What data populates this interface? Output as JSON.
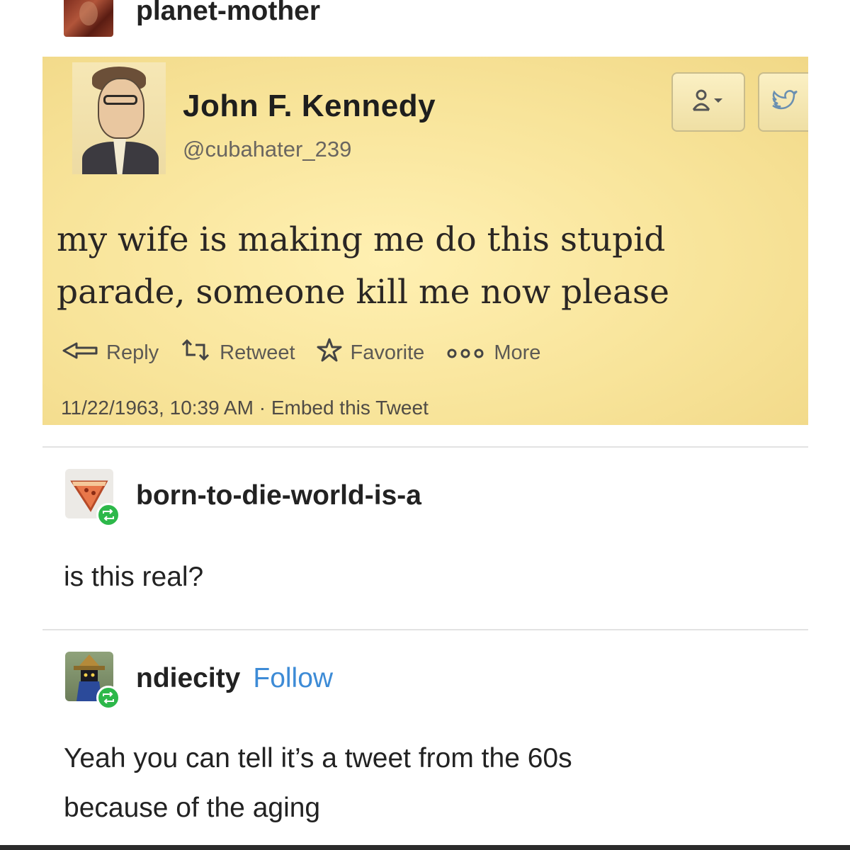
{
  "post": {
    "author": "planet-mother",
    "tweet": {
      "display_name": "John F. Kennedy",
      "handle": "@cubahater_239",
      "text": "my wife is making me do this stupid parade, someone kill me now please",
      "actions": {
        "reply": "Reply",
        "retweet": "Retweet",
        "favorite": "Favorite",
        "more": "More"
      },
      "timestamp": "11/22/1963, 10:39 AM",
      "separator": "·",
      "embed": "Embed this Tweet"
    }
  },
  "reblogs": [
    {
      "username": "born-to-die-world-is-a",
      "comment": "is this real?"
    },
    {
      "username": "ndiecity",
      "follow_label": "Follow",
      "comment_line1": "Yeah you can tell it’s a tweet from the 60s",
      "comment_line2": "because of the aging"
    }
  ],
  "icons": [
    "user-follow-icon",
    "twitter-bird-icon",
    "reply-arrow-icon",
    "retweet-icon",
    "star-icon",
    "more-dots-icon",
    "reblog-icon"
  ],
  "colors": {
    "tweet_background": "#f8e49a",
    "follow_link": "#3d8bd6",
    "reblog_badge": "#2db84a"
  }
}
